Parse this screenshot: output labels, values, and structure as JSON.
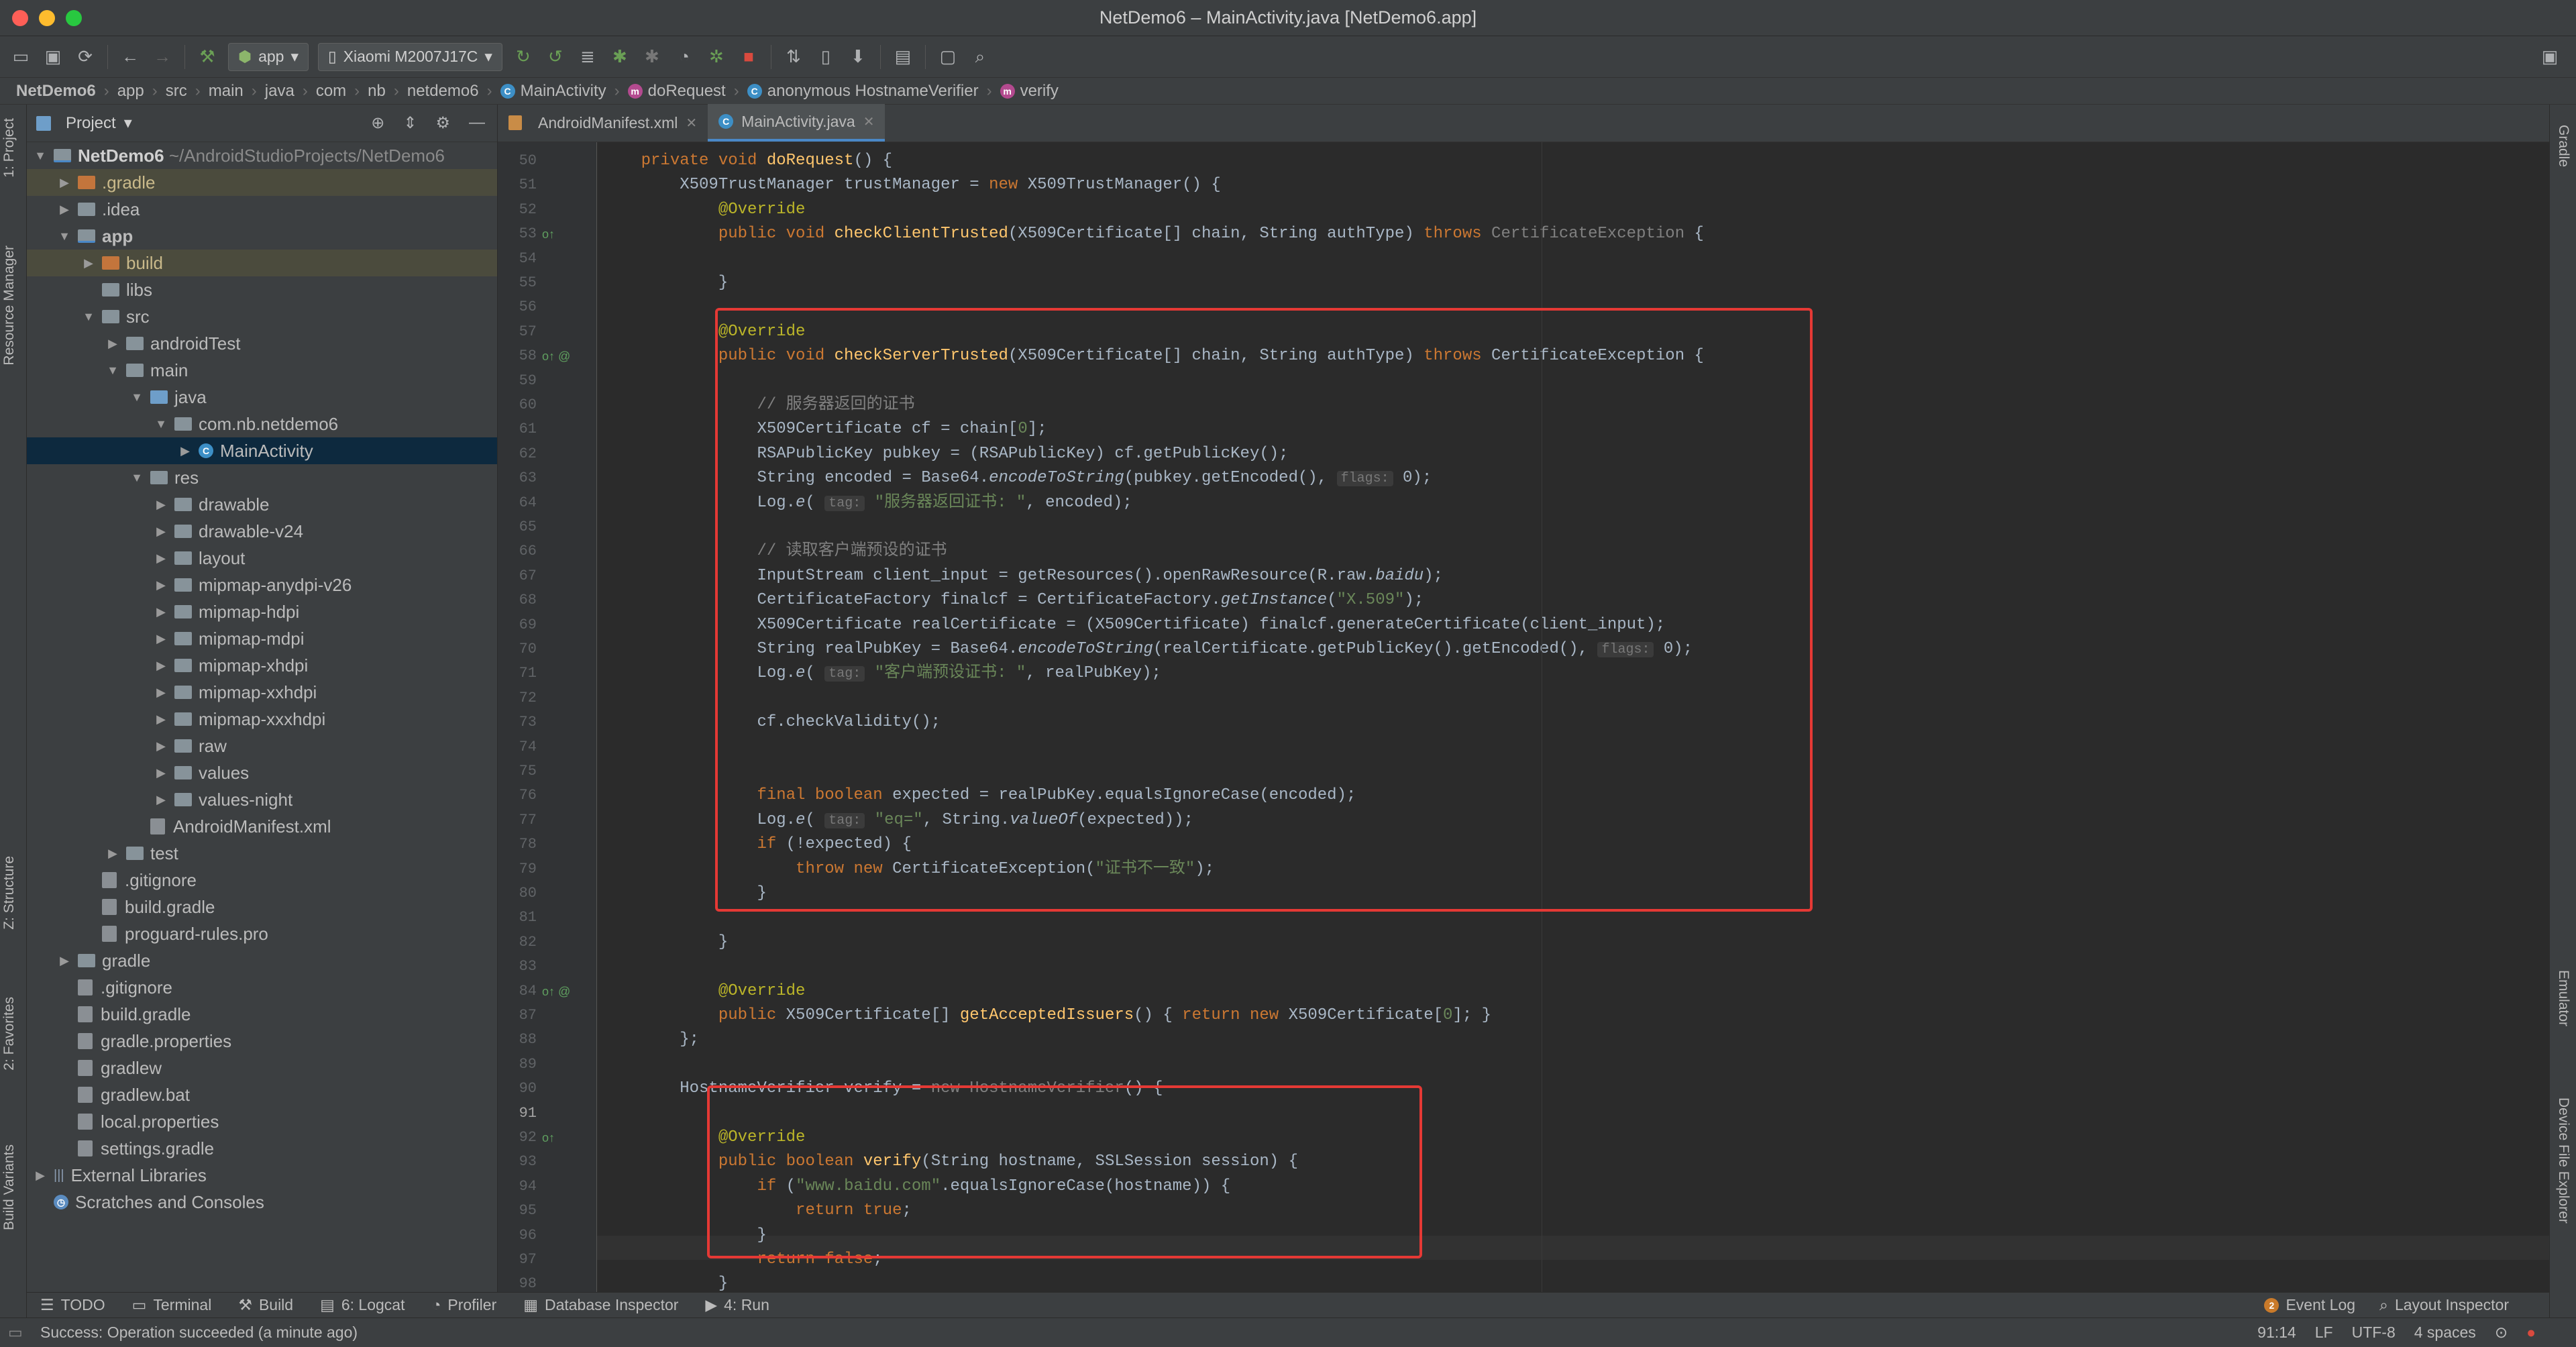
{
  "window": {
    "title": "NetDemo6 – MainActivity.java [NetDemo6.app]"
  },
  "toolbar": {
    "config": "app",
    "device": "Xiaomi M2007J17C"
  },
  "breadcrumb": [
    "NetDemo6",
    "app",
    "src",
    "main",
    "java",
    "com",
    "nb",
    "netdemo6",
    "MainActivity",
    "doRequest",
    "anonymous HostnameVerifier",
    "verify"
  ],
  "left_tabs": [
    "1: Project",
    "Resource Manager",
    "Z: Structure",
    "2: Favorites",
    "Build Variants"
  ],
  "right_tabs": [
    "Gradle",
    "Emulator",
    "Device File Explorer"
  ],
  "project": {
    "header": "Project",
    "root_name": "NetDemo6",
    "root_path": "~/AndroidStudioProjects/NetDemo6",
    "tree": [
      {
        "label": ".gradle",
        "depth": 1,
        "type": "folder-orange",
        "arrow": "right",
        "hl": true
      },
      {
        "label": ".idea",
        "depth": 1,
        "type": "folder",
        "arrow": "right"
      },
      {
        "label": "app",
        "depth": 1,
        "type": "folder-mod",
        "arrow": "down",
        "bold": true
      },
      {
        "label": "build",
        "depth": 2,
        "type": "folder-orange",
        "arrow": "right",
        "hl": true
      },
      {
        "label": "libs",
        "depth": 2,
        "type": "folder",
        "arrow": ""
      },
      {
        "label": "src",
        "depth": 2,
        "type": "folder",
        "arrow": "down"
      },
      {
        "label": "androidTest",
        "depth": 3,
        "type": "folder",
        "arrow": "right"
      },
      {
        "label": "main",
        "depth": 3,
        "type": "folder",
        "arrow": "down"
      },
      {
        "label": "java",
        "depth": 4,
        "type": "folder-blue",
        "arrow": "down"
      },
      {
        "label": "com.nb.netdemo6",
        "depth": 5,
        "type": "folder",
        "arrow": "down"
      },
      {
        "label": "MainActivity",
        "depth": 6,
        "type": "class",
        "arrow": "right",
        "sel": true
      },
      {
        "label": "res",
        "depth": 4,
        "type": "folder",
        "arrow": "down"
      },
      {
        "label": "drawable",
        "depth": 5,
        "type": "folder",
        "arrow": "right"
      },
      {
        "label": "drawable-v24",
        "depth": 5,
        "type": "folder",
        "arrow": "right"
      },
      {
        "label": "layout",
        "depth": 5,
        "type": "folder",
        "arrow": "right"
      },
      {
        "label": "mipmap-anydpi-v26",
        "depth": 5,
        "type": "folder",
        "arrow": "right"
      },
      {
        "label": "mipmap-hdpi",
        "depth": 5,
        "type": "folder",
        "arrow": "right"
      },
      {
        "label": "mipmap-mdpi",
        "depth": 5,
        "type": "folder",
        "arrow": "right"
      },
      {
        "label": "mipmap-xhdpi",
        "depth": 5,
        "type": "folder",
        "arrow": "right"
      },
      {
        "label": "mipmap-xxhdpi",
        "depth": 5,
        "type": "folder",
        "arrow": "right"
      },
      {
        "label": "mipmap-xxxhdpi",
        "depth": 5,
        "type": "folder",
        "arrow": "right"
      },
      {
        "label": "raw",
        "depth": 5,
        "type": "folder",
        "arrow": "right"
      },
      {
        "label": "values",
        "depth": 5,
        "type": "folder",
        "arrow": "right"
      },
      {
        "label": "values-night",
        "depth": 5,
        "type": "folder",
        "arrow": "right"
      },
      {
        "label": "AndroidManifest.xml",
        "depth": 4,
        "type": "file",
        "arrow": ""
      },
      {
        "label": "test",
        "depth": 3,
        "type": "folder",
        "arrow": "right"
      },
      {
        "label": ".gitignore",
        "depth": 2,
        "type": "file",
        "arrow": ""
      },
      {
        "label": "build.gradle",
        "depth": 2,
        "type": "file",
        "arrow": ""
      },
      {
        "label": "proguard-rules.pro",
        "depth": 2,
        "type": "file",
        "arrow": ""
      },
      {
        "label": "gradle",
        "depth": 1,
        "type": "folder",
        "arrow": "right"
      },
      {
        "label": ".gitignore",
        "depth": 1,
        "type": "file",
        "arrow": ""
      },
      {
        "label": "build.gradle",
        "depth": 1,
        "type": "file",
        "arrow": ""
      },
      {
        "label": "gradle.properties",
        "depth": 1,
        "type": "file",
        "arrow": ""
      },
      {
        "label": "gradlew",
        "depth": 1,
        "type": "file",
        "arrow": ""
      },
      {
        "label": "gradlew.bat",
        "depth": 1,
        "type": "file",
        "arrow": ""
      },
      {
        "label": "local.properties",
        "depth": 1,
        "type": "file",
        "arrow": ""
      },
      {
        "label": "settings.gradle",
        "depth": 1,
        "type": "file",
        "arrow": ""
      },
      {
        "label": "External Libraries",
        "depth": 0,
        "type": "lib",
        "arrow": "right"
      },
      {
        "label": "Scratches and Consoles",
        "depth": 0,
        "type": "scratch",
        "arrow": ""
      }
    ]
  },
  "tabs": [
    {
      "label": "AndroidManifest.xml",
      "active": false
    },
    {
      "label": "MainActivity.java",
      "active": true
    }
  ],
  "code": [
    {
      "n": "50",
      "t": [
        [
          "    "
        ],
        [
          "private void ",
          "kw"
        ],
        [
          "doRequest",
          "fn"
        ],
        [
          "() {"
        ]
      ]
    },
    {
      "n": "51",
      "t": [
        [
          "        X509TrustManager trustManager = "
        ],
        [
          "new ",
          "kw"
        ],
        [
          "X509TrustManager() {"
        ]
      ]
    },
    {
      "n": "52",
      "t": [
        [
          "            "
        ],
        [
          "@Override",
          "an"
        ]
      ]
    },
    {
      "n": "53",
      "t": [
        [
          "            "
        ],
        [
          "public void ",
          "kw"
        ],
        [
          "checkClientTrusted",
          "fn"
        ],
        [
          "(X509Certificate[] chain, String authType) "
        ],
        [
          "throws ",
          "kw"
        ],
        [
          "CertificateException",
          "cm"
        ],
        [
          " {"
        ]
      ]
    },
    {
      "n": "54",
      "t": [
        [
          ""
        ]
      ]
    },
    {
      "n": "55",
      "t": [
        [
          "            }"
        ]
      ]
    },
    {
      "n": "56",
      "t": [
        [
          ""
        ]
      ]
    },
    {
      "n": "57",
      "t": [
        [
          "            "
        ],
        [
          "@Override",
          "an"
        ]
      ]
    },
    {
      "n": "58",
      "t": [
        [
          "            "
        ],
        [
          "public void ",
          "kw"
        ],
        [
          "checkServerTrusted",
          "fn"
        ],
        [
          "(X509Certificate[] chain, String authType) "
        ],
        [
          "throws ",
          "kw"
        ],
        [
          "CertificateException {"
        ]
      ]
    },
    {
      "n": "59",
      "t": [
        [
          ""
        ]
      ]
    },
    {
      "n": "60",
      "t": [
        [
          "                "
        ],
        [
          "// 服务器返回的证书",
          "cm"
        ]
      ]
    },
    {
      "n": "61",
      "t": [
        [
          "                X509Certificate cf = chain["
        ],
        [
          "0",
          "st"
        ],
        [
          "];"
        ]
      ]
    },
    {
      "n": "62",
      "t": [
        [
          "                RSAPublicKey pubkey = (RSAPublicKey) cf.getPublicKey();"
        ]
      ]
    },
    {
      "n": "63",
      "t": [
        [
          "                String encoded = Base64."
        ],
        [
          "encodeToString",
          "it"
        ],
        [
          "(pubkey.getEncoded(), "
        ],
        [
          "flags:",
          "hint"
        ],
        [
          " 0);"
        ]
      ]
    },
    {
      "n": "64",
      "t": [
        [
          "                Log."
        ],
        [
          "e",
          "it"
        ],
        [
          "( "
        ],
        [
          "tag:",
          "hint"
        ],
        [
          " "
        ],
        [
          "\"服务器返回证书: \"",
          "st"
        ],
        [
          ", encoded);"
        ]
      ]
    },
    {
      "n": "65",
      "t": [
        [
          ""
        ]
      ]
    },
    {
      "n": "66",
      "t": [
        [
          "                "
        ],
        [
          "// 读取客户端预设的证书",
          "cm"
        ]
      ]
    },
    {
      "n": "67",
      "t": [
        [
          "                InputStream client_input = getResources().openRawResource(R.raw."
        ],
        [
          "baidu",
          "it"
        ],
        [
          ");"
        ]
      ]
    },
    {
      "n": "68",
      "t": [
        [
          "                CertificateFactory finalcf = CertificateFactory."
        ],
        [
          "getInstance",
          "it"
        ],
        [
          "("
        ],
        [
          "\"X.509\"",
          "st"
        ],
        [
          ");"
        ]
      ]
    },
    {
      "n": "69",
      "t": [
        [
          "                X509Certificate realCertificate = (X509Certificate) finalcf.generateCertificate(client_input);"
        ]
      ]
    },
    {
      "n": "70",
      "t": [
        [
          "                String realPubKey = Base64."
        ],
        [
          "encodeToString",
          "it"
        ],
        [
          "(realCertificate.getPublicKey().getEncoded(), "
        ],
        [
          "flags:",
          "hint"
        ],
        [
          " 0);"
        ]
      ]
    },
    {
      "n": "71",
      "t": [
        [
          "                Log."
        ],
        [
          "e",
          "it"
        ],
        [
          "( "
        ],
        [
          "tag:",
          "hint"
        ],
        [
          " "
        ],
        [
          "\"客户端预设证书: \"",
          "st"
        ],
        [
          ", realPubKey);"
        ]
      ]
    },
    {
      "n": "72",
      "t": [
        [
          ""
        ]
      ]
    },
    {
      "n": "73",
      "t": [
        [
          "                cf.checkValidity();"
        ]
      ]
    },
    {
      "n": "74",
      "t": [
        [
          ""
        ]
      ]
    },
    {
      "n": "75",
      "t": [
        [
          ""
        ]
      ]
    },
    {
      "n": "76",
      "t": [
        [
          "                "
        ],
        [
          "final boolean ",
          "kw"
        ],
        [
          "expected = realPubKey.equalsIgnoreCase(encoded);"
        ]
      ]
    },
    {
      "n": "77",
      "t": [
        [
          "                Log."
        ],
        [
          "e",
          "it"
        ],
        [
          "( "
        ],
        [
          "tag:",
          "hint"
        ],
        [
          " "
        ],
        [
          "\"eq=\"",
          "st"
        ],
        [
          ", String."
        ],
        [
          "valueOf",
          "it"
        ],
        [
          "(expected));"
        ]
      ]
    },
    {
      "n": "78",
      "t": [
        [
          "                "
        ],
        [
          "if ",
          "kw"
        ],
        [
          "(!expected) {"
        ]
      ]
    },
    {
      "n": "79",
      "t": [
        [
          "                    "
        ],
        [
          "throw new ",
          "kw"
        ],
        [
          "CertificateException("
        ],
        [
          "\"证书不一致\"",
          "st"
        ],
        [
          ");"
        ]
      ]
    },
    {
      "n": "80",
      "t": [
        [
          "                }"
        ]
      ]
    },
    {
      "n": "81",
      "t": [
        [
          ""
        ]
      ]
    },
    {
      "n": "82",
      "t": [
        [
          "            }"
        ]
      ]
    },
    {
      "n": "83",
      "t": [
        [
          ""
        ]
      ]
    },
    {
      "n": "84",
      "t": [
        [
          "            "
        ],
        [
          "@Override",
          "an"
        ]
      ]
    },
    {
      "n": "87",
      "t": [
        [
          "            "
        ],
        [
          "public ",
          "kw"
        ],
        [
          "X509Certificate[] "
        ],
        [
          "getAcceptedIssuers",
          "fn"
        ],
        [
          "() { "
        ],
        [
          "return new ",
          "kw"
        ],
        [
          "X509Certificate["
        ],
        [
          "0",
          "st"
        ],
        [
          "]; }"
        ]
      ]
    },
    {
      "n": "88",
      "t": [
        [
          "        };"
        ]
      ]
    },
    {
      "n": "89",
      "t": [
        [
          ""
        ]
      ]
    },
    {
      "n": "90",
      "t": [
        [
          "        HostnameVerifier verify = "
        ],
        [
          "new HostnameVerifier",
          "cm"
        ],
        [
          "() {"
        ]
      ]
    },
    {
      "n": "91",
      "t": [
        [
          ""
        ]
      ]
    },
    {
      "n": "92",
      "t": [
        [
          "            "
        ],
        [
          "@Override",
          "an"
        ]
      ]
    },
    {
      "n": "93",
      "t": [
        [
          "            "
        ],
        [
          "public boolean ",
          "kw"
        ],
        [
          "verify",
          "fn"
        ],
        [
          "(String hostname, SSLSession session) {"
        ]
      ]
    },
    {
      "n": "94",
      "t": [
        [
          "                "
        ],
        [
          "if ",
          "kw"
        ],
        [
          "("
        ],
        [
          "\"www.baidu.com\"",
          "st"
        ],
        [
          ".equalsIgnoreCase(hostname)) {"
        ]
      ]
    },
    {
      "n": "95",
      "t": [
        [
          "                    "
        ],
        [
          "return true",
          "kw"
        ],
        [
          ";"
        ]
      ]
    },
    {
      "n": "96",
      "t": [
        [
          "                }"
        ]
      ]
    },
    {
      "n": "97",
      "t": [
        [
          "                "
        ],
        [
          "return false",
          "kw"
        ],
        [
          ";"
        ]
      ]
    },
    {
      "n": "98",
      "t": [
        [
          "            }"
        ]
      ]
    }
  ],
  "toolwindows": [
    "TODO",
    "Terminal",
    "Build",
    "6: Logcat",
    "Profiler",
    "Database Inspector",
    "4: Run"
  ],
  "toolwindows_right": [
    "Event Log",
    "Layout Inspector"
  ],
  "event_count": "2",
  "status": {
    "message": "Success: Operation succeeded (a minute ago)",
    "position": "91:14",
    "line_sep": "LF",
    "encoding": "UTF-8",
    "indent": "4 spaces"
  }
}
